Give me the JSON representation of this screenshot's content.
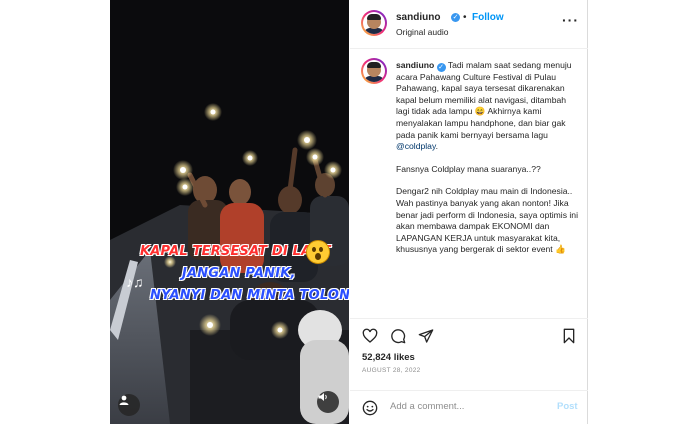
{
  "header": {
    "username": "sandiuno",
    "separator": "•",
    "follow_label": "Follow",
    "audio_label": "Original audio",
    "more_icon": "more-horizontal-icon"
  },
  "media": {
    "caption_line1": "KAPAL TERSESAT DI LAUT",
    "caption_line2": "JANGAN PANIK,",
    "caption_line3": "NYANYI DAN MINTA TOLONG",
    "notes": "♪♫",
    "colors": {
      "red": "#ff2f2f",
      "blue": "#2a4fff"
    }
  },
  "caption": {
    "username": "sandiuno",
    "p1_text": "Tadi malam saat sedang menuju acara Pahawang Culture Festival di Pulau Pahawang, kapal saya tersesat dikarenakan kapal belum memiliki alat navigasi, ditambah lagi tidak ada lampu 😄 Akhirnya kami menyalakan lampu handphone, dan biar gak pada panik kami bernyayi bersama lagu",
    "mention": "@coldplay",
    "p1_end": ".",
    "p2": "Fansnya Coldplay mana suaranya..??",
    "p3": "Dengar2 nih Coldplay mau main di Indonesia.. Wah pastinya banyak yang akan nonton! Jika benar jadi perform di Indonesia, saya optimis ini akan membawa dampak EKONOMI dan LAPANGAN KERJA untuk masyarakat kita, khususnya yang bergerak di sektor event 👍"
  },
  "actions": {
    "likes": "52,824 likes",
    "date": "AUGUST 28, 2022"
  },
  "comment": {
    "placeholder": "Add a comment...",
    "post_label": "Post"
  },
  "accent": "#0095f6"
}
